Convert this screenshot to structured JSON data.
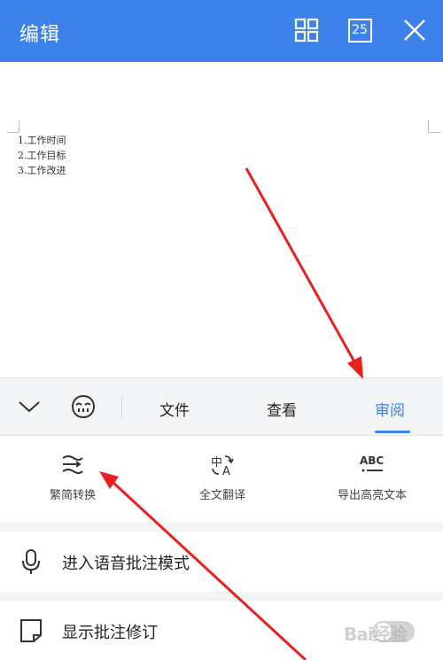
{
  "header": {
    "title": "编辑",
    "grid_icon": "grid-icon",
    "page_count": "25",
    "close_icon": "close-icon",
    "color": "#3d82ea"
  },
  "document": {
    "lines": [
      "1.工作时间",
      "2.工作目标",
      "3.工作改进"
    ]
  },
  "tabbar": {
    "collapse_icon": "chevron-down-icon",
    "assistant_icon": "assistant-face-icon",
    "tabs": [
      {
        "label": "文件",
        "active": false
      },
      {
        "label": "查看",
        "active": false
      },
      {
        "label": "审阅",
        "active": true
      }
    ],
    "active_color": "#3d82ea"
  },
  "tools": [
    {
      "label": "繁简转换",
      "icon": "convert-text-icon"
    },
    {
      "label": "全文翻译",
      "icon": "translate-icon"
    },
    {
      "label": "导出高亮文本",
      "icon": "abc-export-icon"
    }
  ],
  "rows": [
    {
      "label": "进入语音批注模式",
      "icon": "microphone-icon"
    },
    {
      "label": "显示批注修订",
      "icon": "comment-note-icon",
      "toggle_on": false
    }
  ],
  "annotations": {
    "arrow_color": "#e8201f"
  },
  "watermark": "Bai经验"
}
